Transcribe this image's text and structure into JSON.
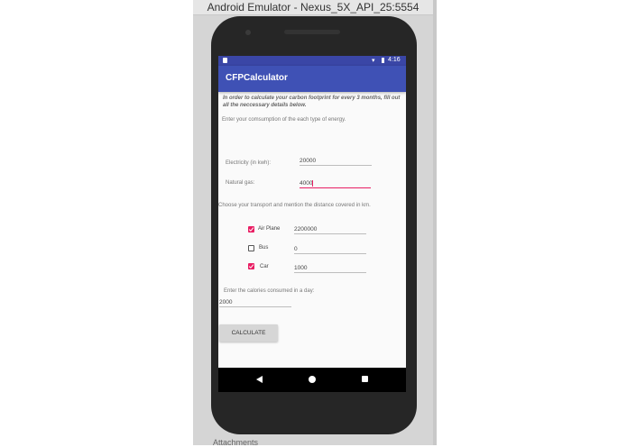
{
  "emulator": {
    "title": "Android Emulator - Nexus_5X_API_25:5554"
  },
  "status_bar": {
    "time": "4:16",
    "icons": [
      "sim-icon",
      "signal-icon",
      "battery-icon"
    ]
  },
  "app_bar": {
    "title": "CFPCalculator"
  },
  "form": {
    "intro": "In order to calculate your carbon footprint for every 3 months, fill out all the neccessary details below.",
    "energy_prompt": "Enter your comsumption of the each type of energy.",
    "electricity": {
      "label": "Electricity (in kwh):",
      "value": "20000"
    },
    "natural_gas": {
      "label": "Natural gas:",
      "value": "4000"
    },
    "transport_prompt": "Choose your transport and mention the distance covered in km.",
    "transports": [
      {
        "label": "Air Plane",
        "checked": true,
        "value": "2200000"
      },
      {
        "label": "Bus",
        "checked": false,
        "value": "0"
      },
      {
        "label": "Car",
        "checked": true,
        "value": "1000"
      }
    ],
    "calories_prompt": "Enter the calories consumed in a day:",
    "calories": {
      "value": "2000"
    },
    "calculate_label": "CALCULATE"
  },
  "nav_bar": {
    "icons": [
      "back-icon",
      "home-icon",
      "recents-icon"
    ]
  },
  "colors": {
    "primary": "#3f51b5",
    "primary_dark": "#3a46a6",
    "accent": "#e91e63"
  },
  "background_text": "Attachments"
}
